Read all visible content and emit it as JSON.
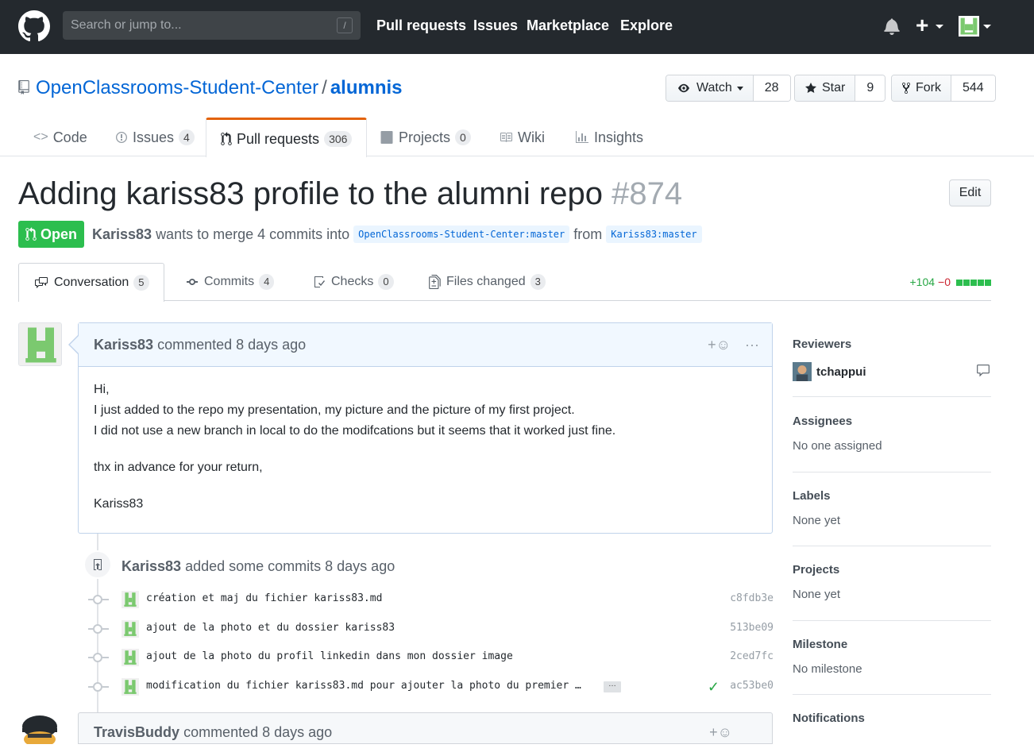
{
  "header": {
    "search_placeholder": "Search or jump to...",
    "slash_key": "/",
    "nav": [
      "Pull requests",
      "Issues",
      "Marketplace",
      "Explore"
    ],
    "plus": "+"
  },
  "repo": {
    "owner": "OpenClassrooms-Student-Center",
    "separator": "/",
    "name": "alumnis",
    "watch_label": "Watch",
    "watch_count": "28",
    "star_label": "Star",
    "star_count": "9",
    "fork_label": "Fork",
    "fork_count": "544"
  },
  "repo_tabs": [
    {
      "label": "Code",
      "count": ""
    },
    {
      "label": "Issues",
      "count": "4"
    },
    {
      "label": "Pull requests",
      "count": "306"
    },
    {
      "label": "Projects",
      "count": "0"
    },
    {
      "label": "Wiki",
      "count": ""
    },
    {
      "label": "Insights",
      "count": ""
    }
  ],
  "pr": {
    "title": "Adding kariss83 profile to the alumni repo",
    "number": "#874",
    "edit_label": "Edit",
    "state": "Open",
    "author": "Kariss83",
    "merge_text": "wants to merge 4 commits into",
    "base_branch": "OpenClassrooms-Student-Center:master",
    "from_text": "from",
    "head_branch": "Kariss83:master"
  },
  "pr_tabs": [
    {
      "label": "Conversation",
      "count": "5"
    },
    {
      "label": "Commits",
      "count": "4"
    },
    {
      "label": "Checks",
      "count": "0"
    },
    {
      "label": "Files changed",
      "count": "3"
    }
  ],
  "diffstat": {
    "additions": "+104",
    "deletions": "−0"
  },
  "comment": {
    "author": "Kariss83",
    "action": "commented 8 days ago",
    "add_reaction": "+",
    "more": "···",
    "body": [
      "Hi,",
      "I just added to the repo my presentation, my picture and the picture of my first project.",
      "I did not use a new branch in local to do the modifcations but it seems that it worked just fine.",
      "thx in advance for your return,",
      "Kariss83"
    ]
  },
  "commit_event": {
    "author": "Kariss83",
    "action": "added some commits 8 days ago"
  },
  "commits": [
    {
      "message": "création et maj du fichier kariss83.md",
      "sha": "c8fdb3e"
    },
    {
      "message": "ajout de la photo et du dossier kariss83",
      "sha": "513be09"
    },
    {
      "message": "ajout de la photo du profil linkedin dans mon dossier image",
      "sha": "2ced7fc"
    },
    {
      "message": "modification du fichier kariss83.md pour ajouter la photo du premier …",
      "sha": "ac53be0",
      "ellipsis": "…",
      "check": "✓"
    }
  ],
  "comment2": {
    "author": "TravisBuddy",
    "action": "commented 8 days ago",
    "add_reaction": "+"
  },
  "sidebar": {
    "reviewers_title": "Reviewers",
    "reviewer": "tchappui",
    "assignees_title": "Assignees",
    "assignees_value": "No one assigned",
    "labels_title": "Labels",
    "labels_value": "None yet",
    "projects_title": "Projects",
    "projects_value": "None yet",
    "milestone_title": "Milestone",
    "milestone_value": "No milestone",
    "notifications_title": "Notifications"
  },
  "colors": {
    "header_bg": "#24292e",
    "link": "#0366d6",
    "open_green": "#2cbe4e",
    "tab_accent": "#e36209",
    "identicon": "#7bc96f"
  }
}
